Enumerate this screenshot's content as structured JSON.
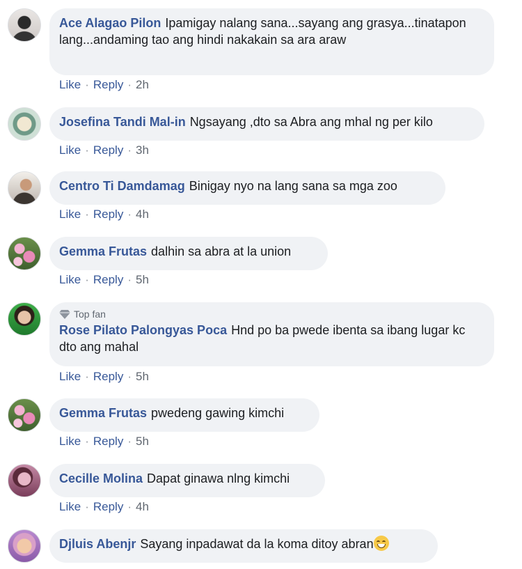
{
  "comments": [
    {
      "author": "Ace Alagao Pilon",
      "text": "Ipamigay nalang sana...sayang ang grasya...tinatapon lang...andaming tao ang hindi nakakain sa ara araw",
      "like": "Like",
      "reply": "Reply",
      "time": "2h"
    },
    {
      "author": "Josefina Tandi Mal-in",
      "text": "Ngsayang ,dto sa Abra ang mhal ng per kilo",
      "like": "Like",
      "reply": "Reply",
      "time": "3h"
    },
    {
      "author": "Centro Ti Damdamag",
      "text": "Binigay nyo na lang sana sa mga zoo",
      "like": "Like",
      "reply": "Reply",
      "time": "4h"
    },
    {
      "author": "Gemma Frutas",
      "text": "dalhin sa abra at la union",
      "like": "Like",
      "reply": "Reply",
      "time": "5h"
    },
    {
      "badge": "Top fan",
      "author": "Rose Pilato Palongyas Poca",
      "text": "Hnd po ba pwede ibenta sa ibang lugar kc dto ang mahal",
      "like": "Like",
      "reply": "Reply",
      "time": "5h"
    },
    {
      "author": "Gemma Frutas",
      "text": "pwedeng gawing kimchi",
      "like": "Like",
      "reply": "Reply",
      "time": "5h"
    },
    {
      "author": "Cecille Molina",
      "text": "Dapat ginawa nlng kimchi",
      "like": "Like",
      "reply": "Reply",
      "time": "4h"
    },
    {
      "author": "Djluis Abenjr",
      "text": "Sayang inpadawat da la koma ditoy abran",
      "emoji": "grinning-face-emoji"
    }
  ],
  "colors": {
    "author": "#385898",
    "bubble": "#f0f2f5",
    "text": "#1c1e21",
    "meta": "#606770"
  }
}
